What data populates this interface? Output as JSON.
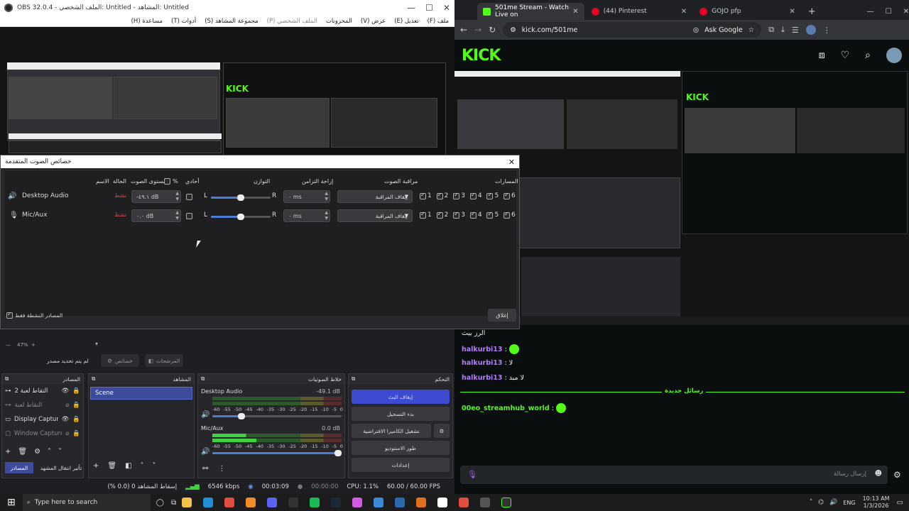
{
  "obs": {
    "title": "OBS 32.0.4 - الملف الشخصي: Untitled - المشاهد: Untitled",
    "menu": [
      "ملف (F)",
      "تعديل (E)",
      "عرض (V)",
      "المخزونات",
      "الملف الشخصي (P)",
      "مجموعة المشاهد (S)",
      "أدوات (T)",
      "مساعدة (H)"
    ]
  },
  "dialog": {
    "title": "خصائص الصوت المتقدمة",
    "headers": {
      "name": "الاسم",
      "status": "الحالة",
      "volume": "مستوى الصوت",
      "percent": "%",
      "mono": "أحادي",
      "balance": "التوازن",
      "sync_offset": "إزاحة التزامن",
      "monitoring": "مراقبة الصوت",
      "tracks": "المسارات"
    },
    "rows": [
      {
        "name": "Desktop Audio",
        "status": "نشط",
        "volume": "-٤٩.١ dB",
        "balance_left": "L",
        "balance_right": "R",
        "balance_fraction": 0.5,
        "sync": "٠ ms",
        "monitoring": "إيقاف المراقبة",
        "tracks": [
          "1",
          "2",
          "3",
          "4",
          "5",
          "6"
        ]
      },
      {
        "name": "Mic/Aux",
        "status": "نشط",
        "volume": "٠.٠ dB",
        "balance_left": "L",
        "balance_right": "R",
        "balance_fraction": 0.5,
        "sync": "٠ ms",
        "monitoring": "إيقاف المراقبة",
        "tracks": [
          "1",
          "2",
          "3",
          "4",
          "5",
          "6"
        ]
      }
    ],
    "active_only_label": "المصادر النشطة فقط",
    "close_button": "إغلاق"
  },
  "obs_bottom": {
    "zoom": "47%",
    "no_source": "لم يتم تحديد مصدر",
    "properties": "خصائص",
    "filters": "المرشحات",
    "docks": {
      "sources": "المصادر",
      "scenes": "المشاهد",
      "mixer": "خلاط الصوتيات",
      "controls": "التحكم"
    },
    "sources": [
      {
        "name": "التقاط لعبة 2",
        "icon": "gamepad-icon"
      },
      {
        "name": "التقاط لعبة",
        "icon": "gamepad-icon"
      },
      {
        "name": "Display Capture",
        "icon": "monitor-icon"
      },
      {
        "name": "Window Capture",
        "icon": "window-icon"
      }
    ],
    "scenes": [
      "Scene"
    ],
    "mixer": [
      {
        "name": "Desktop Audio",
        "level": "-49.1 dB"
      },
      {
        "name": "Mic/Aux",
        "level": "0.0 dB"
      }
    ],
    "meter_ticks": [
      "-60",
      "-55",
      "-50",
      "-45",
      "-40",
      "-35",
      "-30",
      "-25",
      "-20",
      "-15",
      "-10",
      "-5",
      "0"
    ],
    "controls": [
      "إيقاف البث",
      "بدء التسجيل",
      "تشغيل الكاميرا الافتراضية",
      "طور الاستوديو",
      "إعدادات"
    ],
    "tabs": [
      "المصادر",
      "تأثير انتقال المشهد"
    ],
    "status": {
      "dropped": "إسقاط المشاهد 0 (0.0 %)",
      "bitrate": "6546 kbps",
      "stream_time": "00:03:09",
      "rec_time": "00:00:00",
      "cpu": "CPU: 1.1%",
      "fps": "60.00 / 60.00 FPS"
    }
  },
  "chrome": {
    "tabs": [
      {
        "title": "501me Stream - Watch Live on",
        "color": "#53fc18"
      },
      {
        "title": "(44) Pinterest",
        "color": "#e60023"
      },
      {
        "title": "GOJO pfp",
        "color": "#e60023"
      }
    ],
    "url": "kick.com/501me",
    "ask_google": "Ask Google"
  },
  "kick": {
    "logo": "KICK",
    "chat": [
      {
        "user": "",
        "text": "الرز بيث"
      },
      {
        "user": "halkurbi13",
        "text": "",
        "emote": true
      },
      {
        "user": "halkurbi13",
        "text": "لا"
      },
      {
        "user": "halkurbi13",
        "text": "لا مبد"
      }
    ],
    "divider": "رسائل جديدة",
    "after_divider": {
      "user": "00eo_streamhub_world",
      "emote": true
    },
    "input_placeholder": "إرسال رسالة"
  },
  "taskbar": {
    "search": "Type here to search",
    "lang": "ENG",
    "time": "10:13 AM",
    "date": "1/3/2026"
  }
}
